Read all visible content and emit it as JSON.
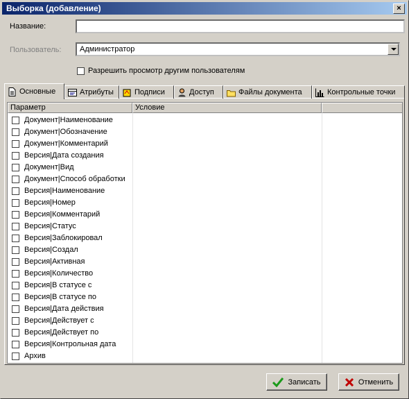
{
  "window": {
    "title": "Выборка (добавление)",
    "close": "×"
  },
  "form": {
    "name_label": "Название:",
    "name_value": "",
    "user_label": "Пользователь:",
    "user_value": "Администратор",
    "share_label": "Разрешить просмотр другим пользователям"
  },
  "tabs": [
    {
      "label": "Основные",
      "icon": "document-icon"
    },
    {
      "label": "Атрибуты",
      "icon": "attributes-icon"
    },
    {
      "label": "Подписи",
      "icon": "signatures-icon"
    },
    {
      "label": "Доступ",
      "icon": "access-icon"
    },
    {
      "label": "Файлы документа",
      "icon": "folder-icon"
    },
    {
      "label": "Контрольные точки",
      "icon": "chart-icon"
    }
  ],
  "grid": {
    "columns": [
      "Параметр",
      "Условие",
      ""
    ],
    "rows": [
      "Документ|Наименование",
      "Документ|Обозначение",
      "Документ|Комментарий",
      "Версия|Дата создания",
      "Документ|Вид",
      "Документ|Способ обработки",
      "Версия|Наименование",
      "Версия|Номер",
      "Версия|Комментарий",
      "Версия|Статус",
      "Версия|Заблокировал",
      "Версия|Создал",
      "Версия|Активная",
      "Версия|Количество",
      "Версия|В статусе с",
      "Версия|В статусе по",
      "Версия|Дата действия",
      "Версия|Действует с",
      "Версия|Действует по",
      "Версия|Контрольная дата",
      "Архив"
    ]
  },
  "buttons": {
    "save": "Записать",
    "cancel": "Отменить"
  },
  "colors": {
    "title_start": "#0a246a",
    "title_end": "#a6caf0",
    "ok_green": "#1a9a1a",
    "cancel_red": "#c00000"
  }
}
